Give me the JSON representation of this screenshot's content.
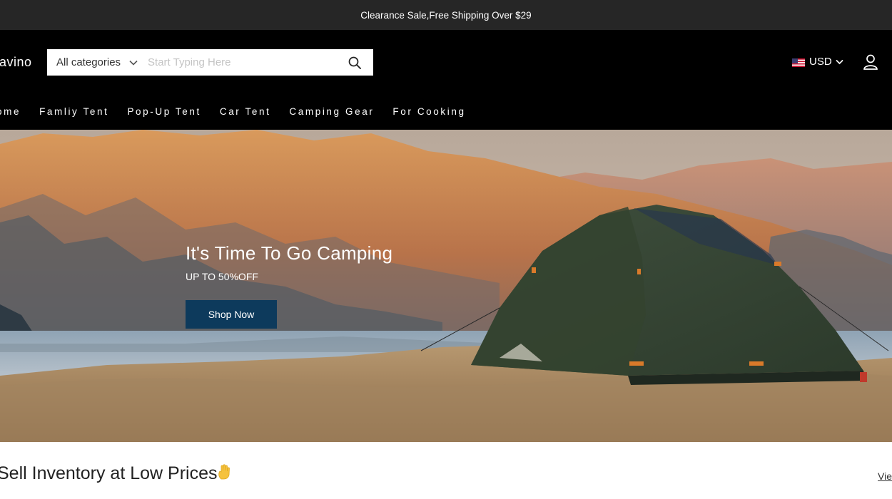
{
  "announcement": "Clearance Sale,Free Shipping Over $29",
  "header": {
    "logo": "avino",
    "search": {
      "category": "All categories",
      "placeholder": "Start Typing Here",
      "search_icon": "search-icon"
    },
    "currency": {
      "label": "USD",
      "flag_icon": "us-flag-icon",
      "chevron_icon": "chevron-down-icon"
    },
    "account_icon": "user-icon"
  },
  "nav": {
    "items": [
      {
        "label": "ome"
      },
      {
        "label": "Famliy Tent"
      },
      {
        "label": "Pop-Up Tent"
      },
      {
        "label": "Car Tent"
      },
      {
        "label": "Camping Gear"
      },
      {
        "label": "For Cooking"
      }
    ]
  },
  "hero": {
    "title": "It's Time To Go Camping",
    "subtitle": "UP TO 50%OFF",
    "button": "Shop Now"
  },
  "section": {
    "title": "Sell Inventory at Low Prices",
    "title_icon": "hand-icon",
    "view_all": "Vie"
  },
  "colors": {
    "announce_bg": "#262626",
    "header_bg": "#000000",
    "button_bg": "#0d3a5c"
  }
}
